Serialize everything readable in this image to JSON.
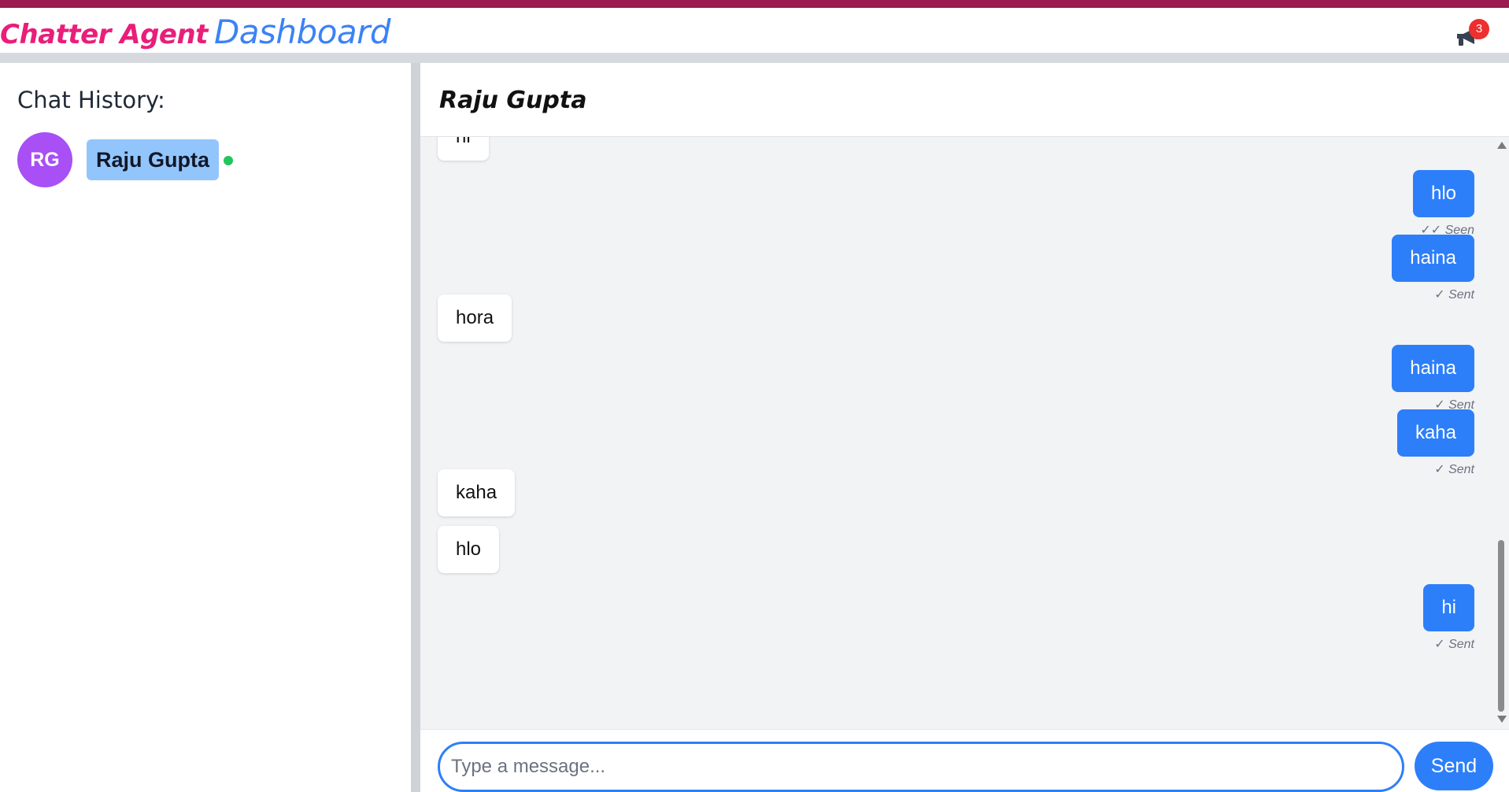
{
  "brand": {
    "name_strong": "Chatter Agent",
    "name_light": "Dashboard"
  },
  "header": {
    "notification_icon": "megaphone-icon",
    "notification_count": "3"
  },
  "sidebar": {
    "title": "Chat History:",
    "contacts": [
      {
        "initials": "RG",
        "name": "Raju Gupta",
        "status": "online"
      }
    ]
  },
  "chat": {
    "contact_name": "Raju Gupta",
    "messages": [
      {
        "direction": "in",
        "text": "hi"
      },
      {
        "direction": "out",
        "text": "hlo",
        "status": "✓✓ Seen"
      },
      {
        "direction": "out",
        "text": "haina",
        "status": "✓ Sent"
      },
      {
        "direction": "in",
        "text": "hora"
      },
      {
        "direction": "out",
        "text": "haina",
        "status": "✓ Sent"
      },
      {
        "direction": "out",
        "text": "kaha",
        "status": "✓ Sent"
      },
      {
        "direction": "in",
        "text": "kaha"
      },
      {
        "direction": "in",
        "text": "hlo"
      },
      {
        "direction": "out",
        "text": "hi",
        "status": "✓ Sent"
      }
    ]
  },
  "composer": {
    "placeholder": "Type a message...",
    "value": "",
    "send_label": "Send"
  },
  "colors": {
    "top_stripe": "#9b1a50",
    "brand_pink": "#e91e7a",
    "brand_blue": "#3b82f6",
    "outgoing_bubble": "#2d7ff9",
    "avatar": "#a84ff5",
    "online": "#22c55e",
    "badge": "#ef2e2e"
  }
}
